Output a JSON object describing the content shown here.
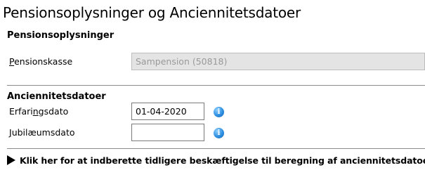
{
  "page": {
    "title": "Pensionsoplysninger og Anciennitetsdatoer"
  },
  "pension": {
    "heading": "Pensionsoplysninger",
    "kasse_label_first": "P",
    "kasse_label_rest": "ensionskasse",
    "kasse_value": "Sampension (50818)"
  },
  "seniority": {
    "heading": "Anciennitetsdatoer",
    "erfaring_label_pre": "Erfari",
    "erfaring_label_u": "n",
    "erfaring_label_post": "gsdato",
    "erfaring_value": "01-04-2020",
    "jubilaeum_label_first": "J",
    "jubilaeum_label_rest": "ubilæumsdato",
    "jubilaeum_value": "",
    "info_icon_glyph": "i"
  },
  "expand": {
    "label": "Klik her for at indberette tidligere beskæftigelse til beregning af anciennitetsdatoer",
    "icon": "triangle-right-icon"
  },
  "colors": {
    "info_icon": "#2e8fe0",
    "readonly_bg": "#e4e4e4",
    "readonly_text": "#9a9a9a",
    "divider": "#8a8a8a"
  }
}
